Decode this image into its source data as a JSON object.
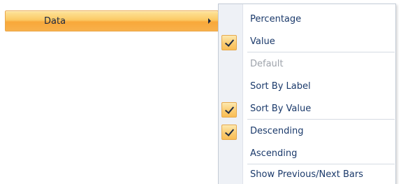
{
  "parent_item": {
    "label": "Data"
  },
  "submenu": {
    "items": [
      {
        "label": "Percentage",
        "checked": false,
        "disabled": false
      },
      {
        "label": "Value",
        "checked": true,
        "disabled": false
      },
      {
        "label": "Default",
        "checked": false,
        "disabled": true
      },
      {
        "label": "Sort By Label",
        "checked": false,
        "disabled": false
      },
      {
        "label": "Sort By Value",
        "checked": true,
        "disabled": false
      },
      {
        "label": "Descending",
        "checked": true,
        "disabled": false
      },
      {
        "label": "Ascending",
        "checked": false,
        "disabled": false
      },
      {
        "label": "Show Previous/Next Bars",
        "checked": false,
        "disabled": false
      }
    ]
  },
  "colors": {
    "highlight": "#f8a83a",
    "text": "#1b3a6b",
    "disabled_text": "#9ea3ab",
    "gutter": "#eef1f6"
  }
}
